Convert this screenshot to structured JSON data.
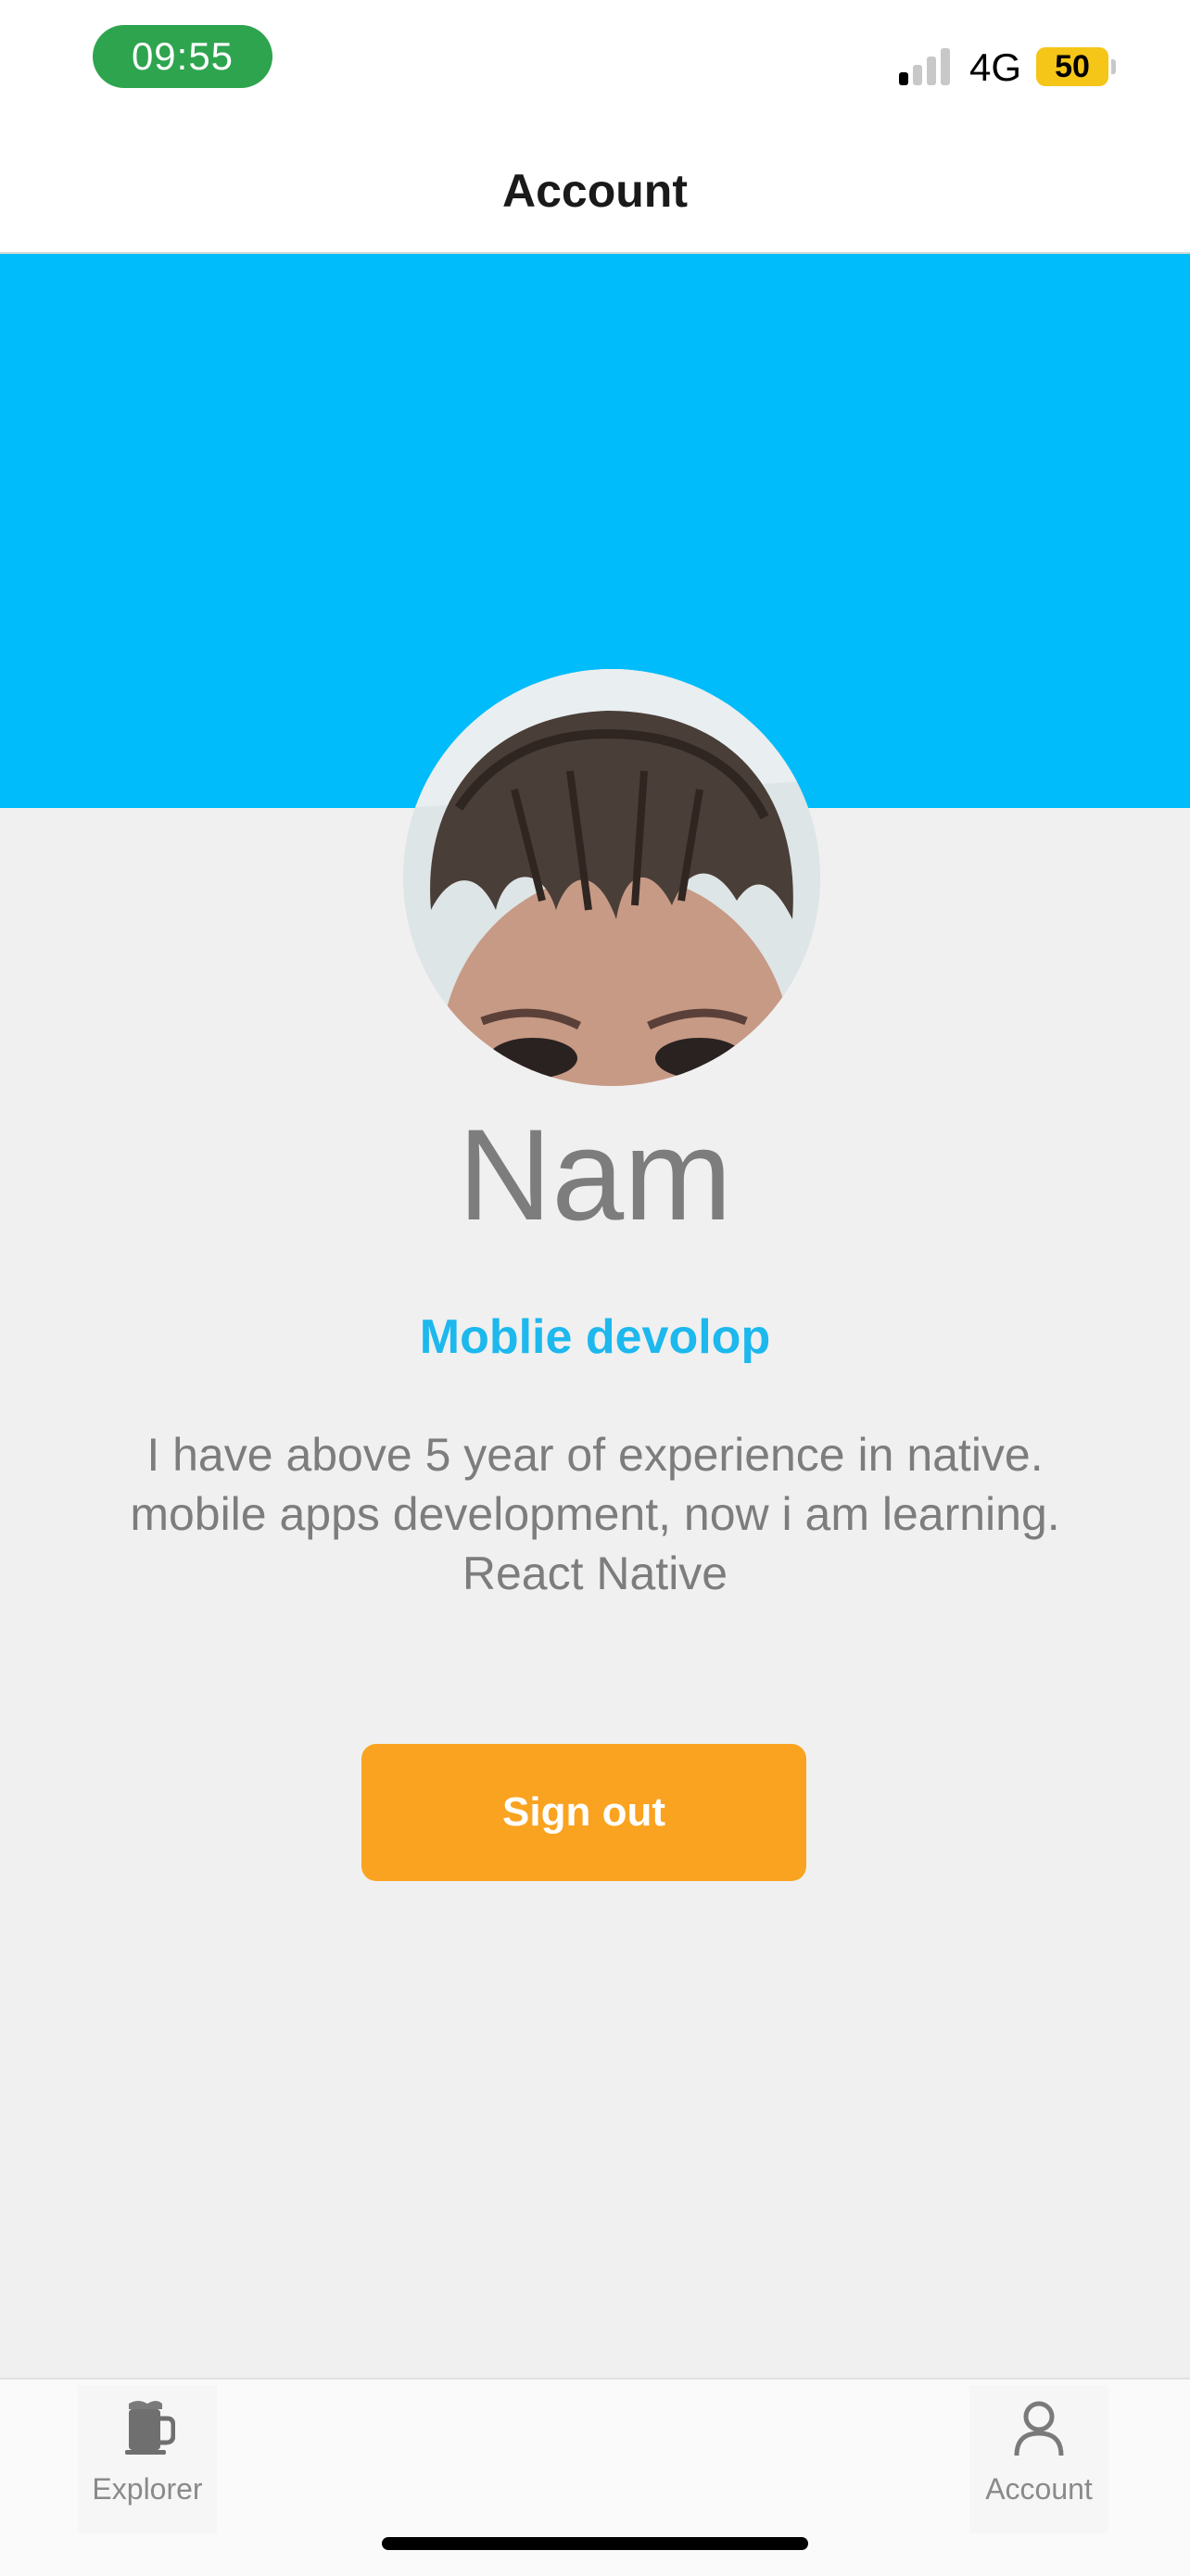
{
  "status_bar": {
    "time": "09:55",
    "network": "4G",
    "battery": "50",
    "time_pill_color": "#2ea44f",
    "battery_color": "#f5c518"
  },
  "header": {
    "title": "Account"
  },
  "banner": {
    "color": "#00bcfa"
  },
  "profile": {
    "avatar_icon": "profile-photo",
    "name": "Nam",
    "role": "Moblie devolop",
    "bio": "I have above 5 year of experience in native. mobile apps development, now i am learning. React Native",
    "role_color": "#1cb8ee"
  },
  "actions": {
    "sign_out_label": "Sign out",
    "sign_out_color": "#f9a320"
  },
  "tab_bar": {
    "items": [
      {
        "label": "Explorer",
        "icon": "mug-icon"
      },
      {
        "label": "Account",
        "icon": "person-icon"
      }
    ]
  }
}
